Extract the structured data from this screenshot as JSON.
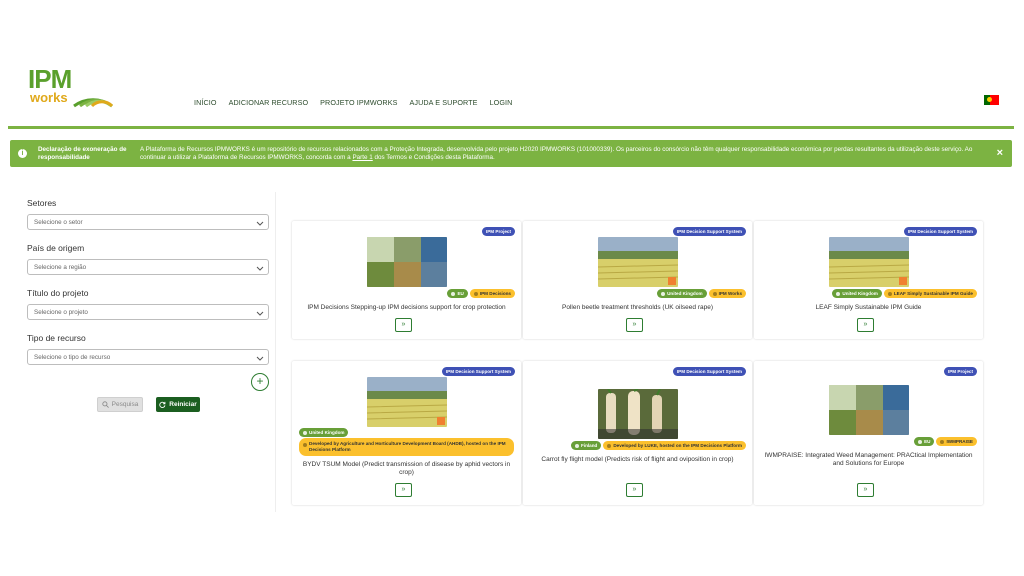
{
  "logo": {
    "ipm": "IPM",
    "works": "works"
  },
  "nav": [
    "INÍCIO",
    "ADICIONAR RECURSO",
    "PROJETO IPMWORKS",
    "AJUDA E SUPORTE",
    "LOGIN"
  ],
  "disclaimer": {
    "title": "Declaração de exoneração de responsabilidade",
    "text_before_link": "A Plataforma de Recursos IPMWORKS é um repositório de recursos relacionados com a Proteção Integrada, desenvolvida pelo projeto H2020 IPMWORKS (101000339). Os parceiros do consórcio não têm qualquer responsabilidade económica por perdas resultantes da utilização deste serviço. Ao continuar a utilizar a Plataforma de Recursos IPMWORKS, concorda com a ",
    "link": "Parte 1",
    "text_after_link": " dos Termos e Condições desta Plataforma.",
    "close": "×"
  },
  "filters": {
    "sectors_label": "Setores",
    "sectors_placeholder": "Selecione o setor",
    "country_label": "País de origem",
    "country_placeholder": "Selecione a região",
    "project_label": "Título do projeto",
    "project_placeholder": "Selecione o projeto",
    "type_label": "Tipo de recurso",
    "type_placeholder": "Selecione o tipo de recurso",
    "add": "+",
    "search": "Pesquisa",
    "reset": "Reiniciar"
  },
  "cards": [
    {
      "type": "IPM Project",
      "tags": [
        {
          "text": "EU",
          "color": "green"
        },
        {
          "text": "IPM Decisions",
          "color": "yellow"
        }
      ],
      "title": "IPM Decisions Stepping-up IPM decisions support for crop protection",
      "thumb": "greenhouse"
    },
    {
      "type": "IPM Decision Support System",
      "tags": [
        {
          "text": "United Kingdom",
          "color": "green"
        },
        {
          "text": "IPM Works",
          "color": "yellow"
        }
      ],
      "title": "Pollen beetle treatment thresholds (UK oilseed rape)",
      "thumb": "field"
    },
    {
      "type": "IPM Decision Support System",
      "tags": [
        {
          "text": "United Kingdom",
          "color": "green"
        },
        {
          "text": "LEAF Simply Sustainable IPM Guide",
          "color": "yellow"
        }
      ],
      "title": "LEAF Simply Sustainable IPM Guide",
      "thumb": "field"
    },
    {
      "type": "IPM Decision Support System",
      "tags": [
        {
          "text": "United Kingdom",
          "color": "green"
        }
      ],
      "long_tag": "Developed by Agriculture and Horticulture Development Board (AHDB), hosted on the IPM Decisions Platform",
      "title": "BYDV TSUM Model (Predict transmission of disease by aphid vectors in crop)",
      "thumb": "field"
    },
    {
      "type": "IPM Decision Support System",
      "tags": [
        {
          "text": "Finland",
          "color": "green"
        },
        {
          "text": "Developed by LUKE, hosted on the IPM Decisions Platform",
          "color": "yellow"
        }
      ],
      "title": "Carrot fly flight model (Predicts risk of flight and oviposition in crop)",
      "thumb": "carrot"
    },
    {
      "type": "IPM Project",
      "tags": [
        {
          "text": "EU",
          "color": "green"
        },
        {
          "text": "IWMPRAISE",
          "color": "yellow"
        }
      ],
      "title": "IWMPRAISE: Integrated Weed Management: PRACtical Implementation and Solutions for Europe",
      "thumb": "greenhouse"
    }
  ],
  "open_button": "»",
  "colors": {
    "brand_green": "#7cb342",
    "dark_green": "#1b5e20",
    "badge_blue": "#3f51b5",
    "tag_yellow": "#fbc02d"
  }
}
